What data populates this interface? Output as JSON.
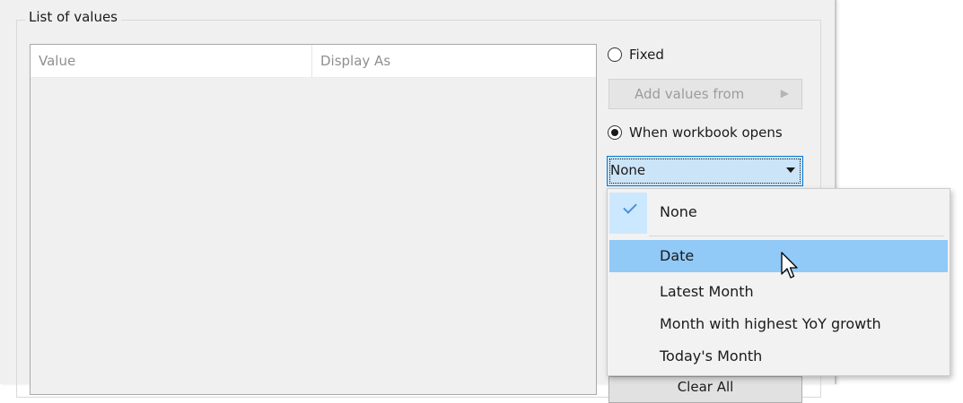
{
  "group_title": "List of values",
  "list": {
    "columns": [
      "Value",
      "Display As"
    ],
    "rows": []
  },
  "options": {
    "fixed_label": "Fixed",
    "fixed_selected": false,
    "add_values_label": "Add values from",
    "add_values_enabled": false,
    "workbook_label": "When workbook opens",
    "workbook_selected": true
  },
  "combo": {
    "selected": "None",
    "items": [
      {
        "label": "None",
        "checked": true
      },
      {
        "label": "Date",
        "hovered": true
      },
      {
        "label": "Latest Month"
      },
      {
        "label": "Month with highest YoY growth"
      },
      {
        "label": "Today's Month"
      }
    ]
  },
  "clear_all_label": "Clear All",
  "colors": {
    "dialog_bg": "#f0f0f0",
    "hover": "#91c9f7",
    "check_bg": "#cce8ff",
    "combo_focus": "#cce4f7",
    "accent": "#0078d7"
  }
}
